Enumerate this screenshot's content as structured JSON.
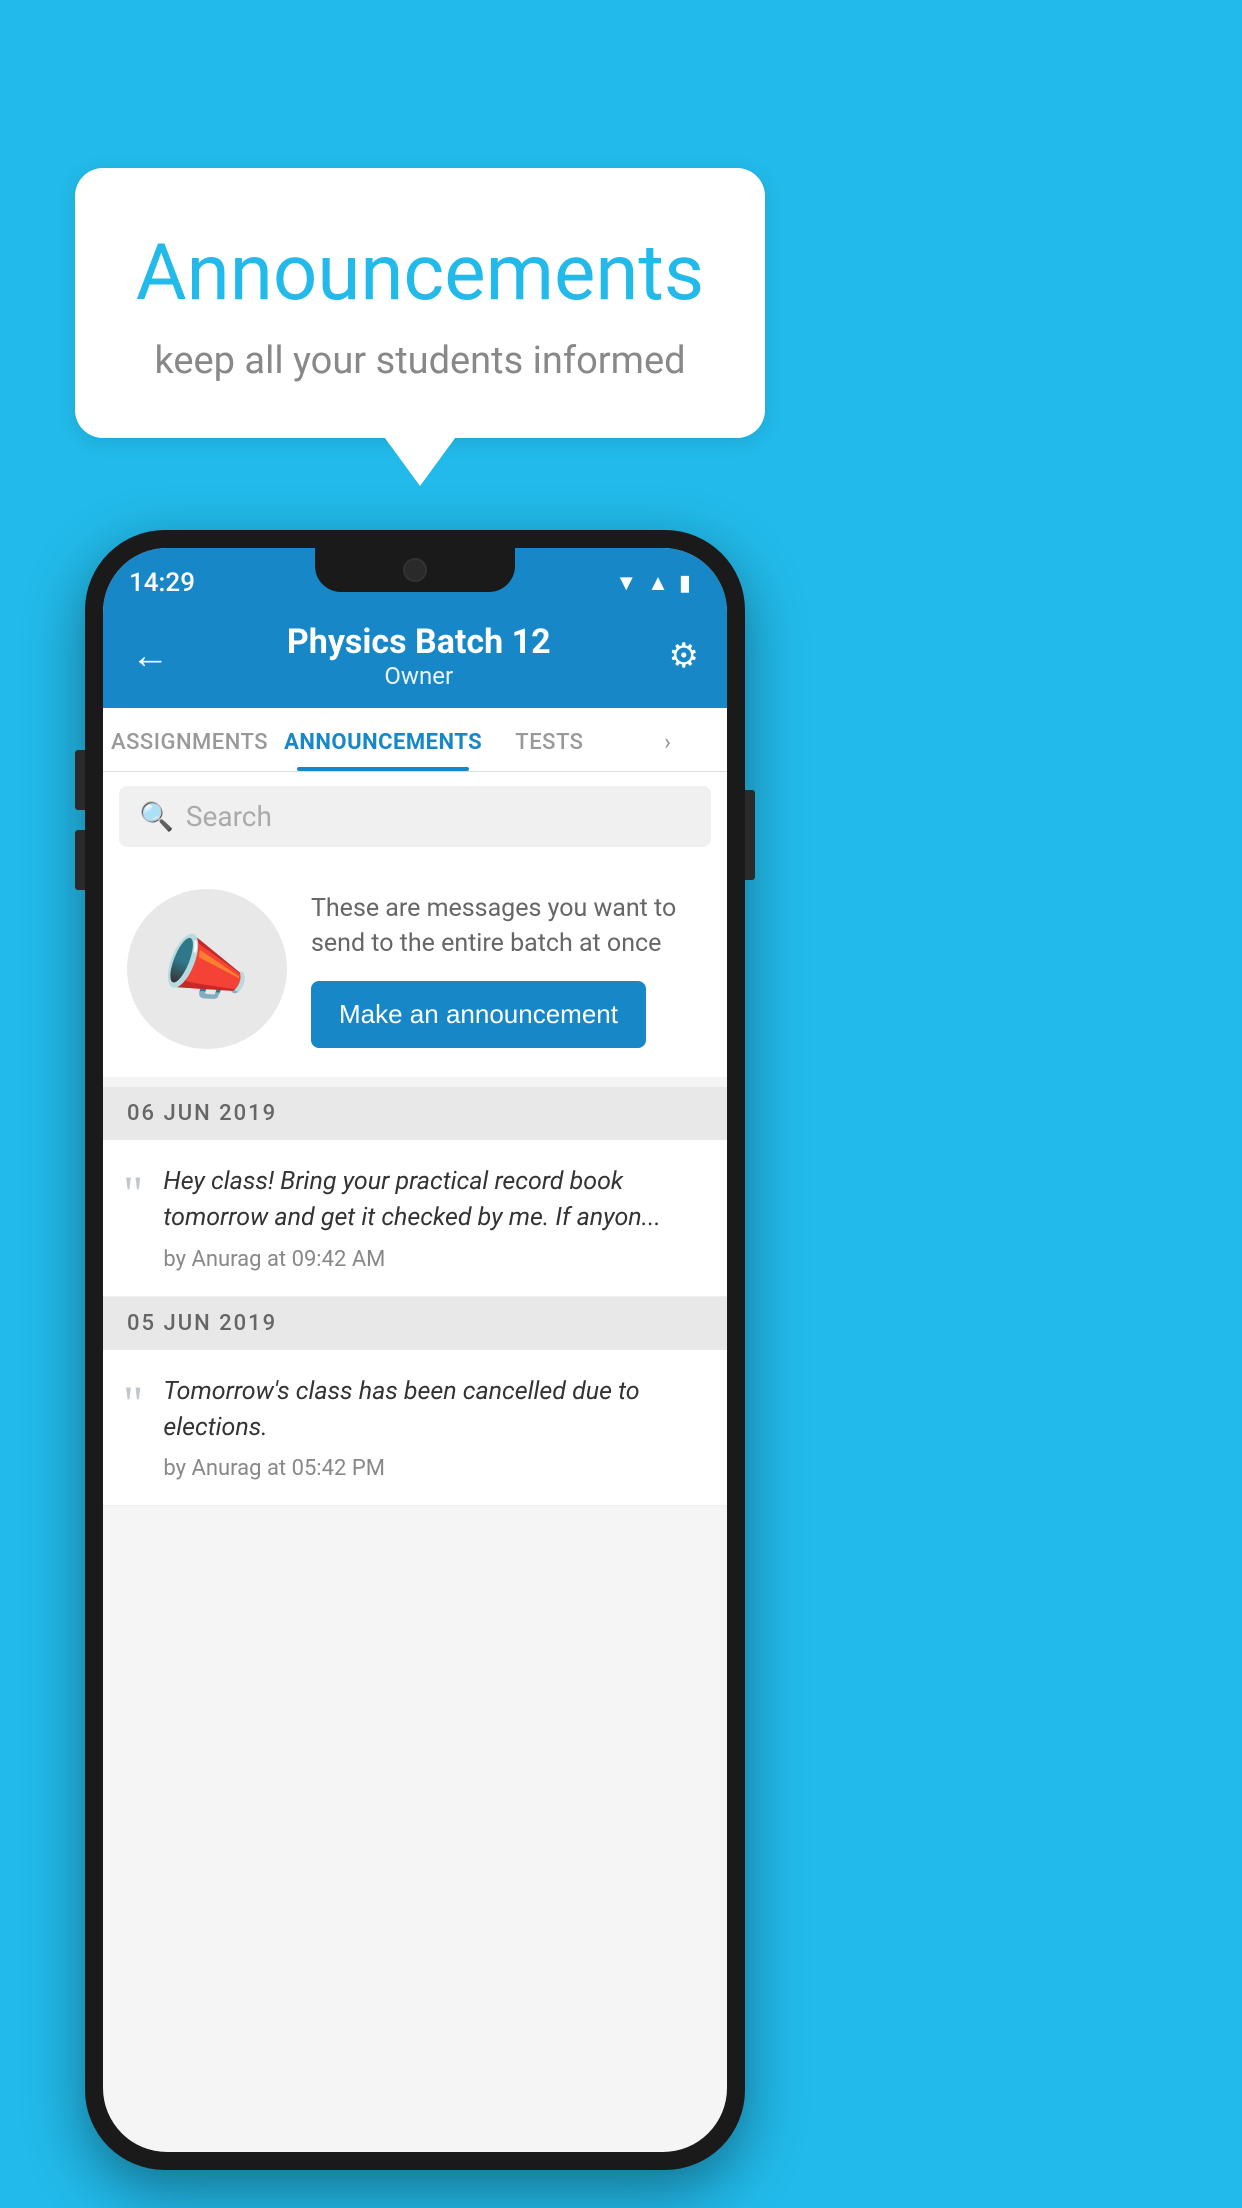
{
  "background_color": "#22BAEA",
  "speech_bubble": {
    "title": "Announcements",
    "subtitle": "keep all your students informed"
  },
  "phone": {
    "status_bar": {
      "time": "14:29",
      "wifi": "▲",
      "signal": "◀",
      "battery": "▮"
    },
    "header": {
      "back_label": "←",
      "title": "Physics Batch 12",
      "subtitle": "Owner",
      "settings_label": "⚙"
    },
    "tabs": [
      {
        "label": "ASSIGNMENTS",
        "active": false
      },
      {
        "label": "ANNOUNCEMENTS",
        "active": true
      },
      {
        "label": "TESTS",
        "active": false
      },
      {
        "label": "•",
        "active": false
      }
    ],
    "search": {
      "placeholder": "Search"
    },
    "cta": {
      "description": "These are messages you want to send to the entire batch at once",
      "button_label": "Make an announcement"
    },
    "announcements": [
      {
        "date": "06  JUN  2019",
        "text": "Hey class! Bring your practical record book tomorrow and get it checked by me. If anyon...",
        "meta": "by Anurag at 09:42 AM"
      },
      {
        "date": "05  JUN  2019",
        "text": "Tomorrow's class has been cancelled due to elections.",
        "meta": "by Anurag at 05:42 PM"
      }
    ]
  }
}
